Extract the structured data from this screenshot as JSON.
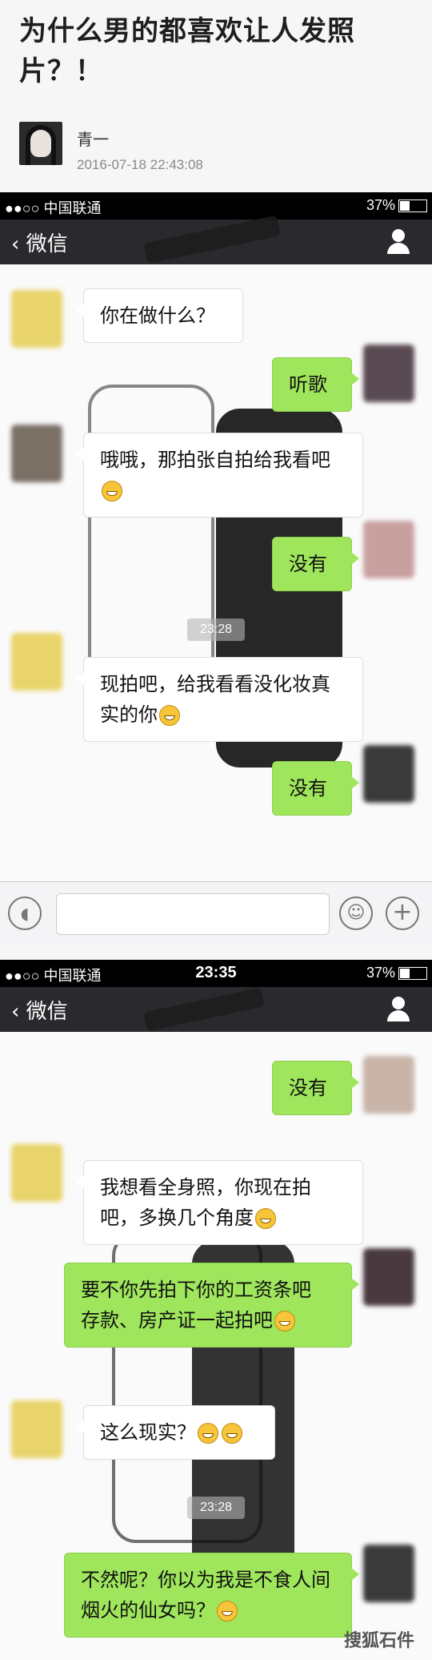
{
  "post": {
    "title": "为什么男的都喜欢让人发照片？！",
    "author": "青一",
    "date": "2016-07-18 22:43:08"
  },
  "screen1": {
    "status": {
      "carrier": "●●○○ 中国联通",
      "time": "",
      "battery": "37%"
    },
    "nav": {
      "back_label": "微信",
      "title": ""
    },
    "messages": [
      {
        "side": "in",
        "text": "你在做什么？"
      },
      {
        "side": "out",
        "text": "听歌"
      },
      {
        "side": "in",
        "text": "哦哦，那拍张自拍给我看吧"
      },
      {
        "side": "out",
        "text": "没有"
      },
      {
        "side": "in",
        "text": "现拍吧，给我看看没化妆真实的你"
      },
      {
        "side": "out",
        "text": "没有"
      }
    ],
    "timestamp": "23:28"
  },
  "screen2": {
    "status": {
      "carrier": "●●○○ 中国联通",
      "time": "23:35",
      "battery": "37%"
    },
    "nav": {
      "back_label": "微信",
      "title": ""
    },
    "messages": [
      {
        "side": "out",
        "text": "没有"
      },
      {
        "side": "in",
        "text": "我想看全身照，你现在拍吧，多换几个角度"
      },
      {
        "side": "out",
        "text": "要不你先拍下你的工资条吧 存款、房产证一起拍吧"
      },
      {
        "side": "in",
        "text": "这么现实？"
      },
      {
        "side": "out",
        "text": "不然呢？你以为我是不食人间烟火的仙女吗？"
      }
    ],
    "timestamp": "23:28"
  },
  "watermark": "搜狐石件",
  "icons": {
    "back": "chevron-left-icon",
    "contact": "person-icon",
    "voice": "voice-icon",
    "emoji": "emoji-icon",
    "plus": "plus-icon",
    "smiley": "grin-emoji-icon"
  },
  "colors": {
    "out_bubble": "#9fe65c",
    "nav_bg": "#2a2a2e"
  }
}
